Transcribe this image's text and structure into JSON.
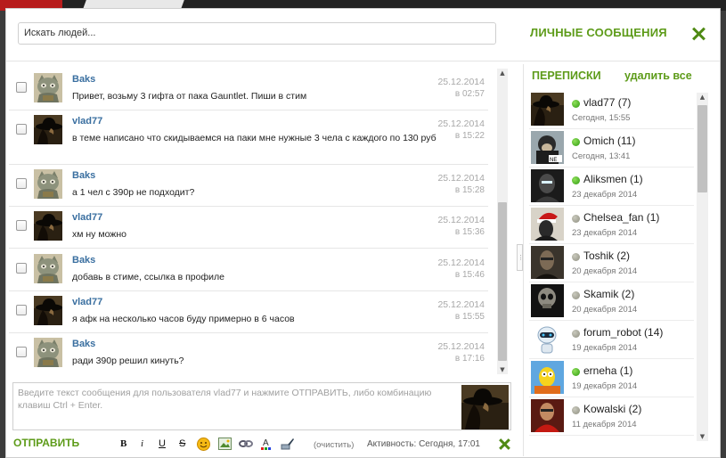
{
  "header": {
    "search_value": "Искать людей...",
    "title": "ЛИЧНЫЕ СООБЩЕНИЯ"
  },
  "messages": [
    {
      "author": "Baks",
      "text": "Привет, возьму 3 гифта от пака Gauntlet. Пиши в стим",
      "date": "25.12.2014",
      "time": "в 02:57",
      "avatar": "cat-avatar-icon"
    },
    {
      "author": "vlad77",
      "text": "в теме написано что скидываемся на паки мне нужные 3 чела с каждого по 130 руб",
      "date": "25.12.2014",
      "time": "в 15:22",
      "avatar": "hat-silhouette-avatar-icon"
    },
    {
      "author": "Baks",
      "text": "а 1 чел с 390р не подходит?",
      "date": "25.12.2014",
      "time": "в 15:28",
      "avatar": "cat-avatar-icon"
    },
    {
      "author": "vlad77",
      "text": "хм ну можно",
      "date": "25.12.2014",
      "time": "в 15:36",
      "avatar": "hat-silhouette-avatar-icon"
    },
    {
      "author": "Baks",
      "text": "добавь в стиме, ссылка в профиле",
      "date": "25.12.2014",
      "time": "в 15:46",
      "avatar": "cat-avatar-icon"
    },
    {
      "author": "vlad77",
      "text": "я афк на несколько часов буду примерно в 6 часов",
      "date": "25.12.2014",
      "time": "в 15:55",
      "avatar": "hat-silhouette-avatar-icon"
    },
    {
      "author": "Baks",
      "text": "ради 390р решил кинуть?",
      "date": "25.12.2014",
      "time": "в 17:16",
      "avatar": "cat-avatar-icon"
    }
  ],
  "compose": {
    "placeholder": "Введите текст сообщения для пользователя vlad77 и нажмите ОТПРАВИТЬ, либо комбинацию клавиш Ctrl + Enter.",
    "send_label": "ОТПРАВИТЬ",
    "toolbar": {
      "bold": "B",
      "italic": "i",
      "underline": "U",
      "strike": "S",
      "icons": [
        "smiley-icon",
        "image-icon",
        "link-icon",
        "font-color-icon",
        "brush-icon"
      ]
    },
    "clear_label": "(очистить)",
    "activity": "Активность: Сегодня, 17:01"
  },
  "conversations_panel": {
    "title": "ПЕРЕПИСКИ",
    "delete_all": "удалить все",
    "items": [
      {
        "name": "vlad77 (7)",
        "when": "Сегодня, 15:55",
        "online": true,
        "avatar": "hat-silhouette-avatar-icon"
      },
      {
        "name": "Omich (11)",
        "when": "Сегодня, 13:41",
        "online": true,
        "avatar": "monkey-avatar-icon"
      },
      {
        "name": "Aliksmen (1)",
        "when": "23 декабря 2014",
        "online": true,
        "avatar": "armored-soldier-avatar-icon"
      },
      {
        "name": "Chelsea_fan (1)",
        "when": "23 декабря 2014",
        "online": false,
        "avatar": "santa-hat-avatar-icon"
      },
      {
        "name": "Toshik (2)",
        "when": "20 декабря 2014",
        "online": false,
        "avatar": "dark-portrait-avatar-icon"
      },
      {
        "name": "Skamik (2)",
        "when": "20 декабря 2014",
        "online": false,
        "avatar": "skull-avatar-icon"
      },
      {
        "name": "forum_robot (14)",
        "when": "19 декабря 2014",
        "online": false,
        "avatar": "robot-avatar-icon"
      },
      {
        "name": "erneha (1)",
        "when": "19 декабря 2014",
        "online": true,
        "avatar": "simpsons-avatar-icon"
      },
      {
        "name": "Kowalski (2)",
        "when": "11 декабря 2014",
        "online": false,
        "avatar": "red-hero-avatar-icon"
      }
    ]
  },
  "colors": {
    "accent_green": "#5d9b19",
    "author_blue": "#3a6fa0",
    "online_green": "#2f9a10",
    "offline_gray": "#8e8e80"
  }
}
